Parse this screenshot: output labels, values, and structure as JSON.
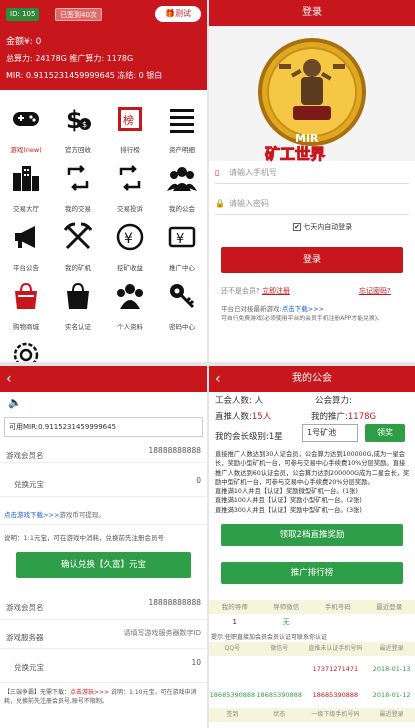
{
  "home": {
    "id_badge": "ID: 105",
    "days_badge": "已签到40次",
    "test_button": "测试",
    "gold_line": "金额¥: 0",
    "compute_line": "总算力: 24178G 推广算力: 1178G",
    "mir_line": "MIR: 0.9115231459999645 冻结: 0 银白",
    "tiles": [
      {
        "label": "游戏(new)",
        "icon": "gamepad-icon",
        "red": true
      },
      {
        "label": "官方回收",
        "icon": "dollar-recycle-icon",
        "red": false
      },
      {
        "label": "排行榜",
        "icon": "ranking-badge-icon",
        "red": false
      },
      {
        "label": "资产明细",
        "icon": "list-icon",
        "red": false
      },
      {
        "label": "交易大厅",
        "icon": "buildings-icon",
        "red": false
      },
      {
        "label": "我的交易",
        "icon": "exchange-icon",
        "red": false
      },
      {
        "label": "交易投诉",
        "icon": "exchange-complaint-icon",
        "red": false
      },
      {
        "label": "我的公会",
        "icon": "users-icon",
        "red": false
      },
      {
        "label": "平台公告",
        "icon": "megaphone-icon",
        "red": false
      },
      {
        "label": "我的矿机",
        "icon": "pickaxe-icon",
        "red": false
      },
      {
        "label": "挖矿收益",
        "icon": "yuan-circle-icon",
        "red": false
      },
      {
        "label": "推广中心",
        "icon": "yuan-ticket-icon",
        "red": false
      },
      {
        "label": "购物商城",
        "icon": "shopping-bag-icon",
        "red": false
      },
      {
        "label": "实名认证",
        "icon": "bag-icon",
        "red": false
      },
      {
        "label": "个人资料",
        "icon": "team-icon",
        "red": false
      },
      {
        "label": "密码中心",
        "icon": "key-icon",
        "red": false
      },
      {
        "label": "",
        "icon": "settings-icon",
        "red": false
      }
    ]
  },
  "login": {
    "title": "登录",
    "logo_text": "MIR",
    "logo_subtitle": "矿工世界",
    "phone_placeholder": "请输入手机号",
    "password_placeholder": "请输入密码",
    "remember_label": "七天内自动登录",
    "login_button": "登录",
    "no_account": "还不是会员?",
    "register_link": "立即注册",
    "forgot_link": "忘记密码?",
    "note1_prefix": "平台已对接最新游戏:",
    "note1_link": "点击下载>>>",
    "note2": "可自行免费游戏(必须使用平台的会员手机注册APP才能兑换)。"
  },
  "exchange": {
    "speaker_icon": "speaker-icon",
    "mir_value": "可用MIR:0.9115231459999645",
    "game_member_label": "游戏会员名",
    "game_member_value": "18888888888",
    "exchange_label": "兑换元宝",
    "exchange_value": "0",
    "download_link": "点击游戏下载>>>",
    "download_tip": "游戏币可提现。",
    "rate_note": "说明：1:1元宝，可在游戏中消耗，兑换前先注册会员号",
    "confirm_button": "确认兑换【久富】元宝",
    "member2_label": "游戏会员名",
    "member2_value": "18888888888",
    "server_label": "游戏服务器",
    "server_value": "请填写游戏服务器数字ID",
    "exchange2_label": "兑换元宝",
    "exchange2_value": "10",
    "footer_prefix": "【三端争霸】无需下载：",
    "footer_link": "点击游玩>>>",
    "footer_text": " 说明：1:10元宝，可在游戏中消耗，兑换前先注册会员号,账号不限制。"
  },
  "guild": {
    "title": "我的公会",
    "members_label": "工会人数: 人",
    "power_label": "公会算力:",
    "direct_label": "直推人数:",
    "direct_value": "15人",
    "promo_label": "我的推广:",
    "promo_value": "1178G",
    "level_label": "我的会长级别:",
    "level_value": "1星",
    "pool_value": "1号矿池",
    "claim_button": "领奖",
    "rules": [
      "直接推广人数达到30人证会员，公会算力达到100000G,成为一星会长，奖励小型矿机一台，可参与交易中心手续费10%分层奖励。直接推广人数达到60认证会员，公会算力达到200000G成为二星会长，奖励中型矿机一台，可参与交易中心手续费20%分层奖励。",
      "直推满10人并且【认证】奖励微型矿机一台。(1张)",
      "直推满100人并且【认证】奖励小型矿机一台。(2张)",
      "直推满300人并且【认证】奖励中型矿机一台。(3张)"
    ],
    "reward_button": "领取2档直推奖励",
    "rank_button": "推广排行榜",
    "table1_headers": [
      "我的导师",
      "导师微信",
      "手机号码",
      "最近登录"
    ],
    "table1_rows": [
      [
        "1",
        "无",
        "",
        ""
      ]
    ],
    "tip": "提示:任职直接加会员会员认证可联系你认证",
    "table2_headers": [
      "QQ号",
      "微信号",
      "直推未认证手机号码",
      "最近登录"
    ],
    "table2_rows": [
      [
        "",
        "",
        "17371271471",
        "2018-01-13"
      ],
      [
        "18685390888",
        "18685390888",
        "18685390888",
        "2018-01-12"
      ]
    ],
    "table3_headers": [
      "签到",
      "状态",
      "一级下级手机号码",
      "最近登录"
    ],
    "accent_red": "#c8161d",
    "accent_green": "#2f9e48"
  }
}
